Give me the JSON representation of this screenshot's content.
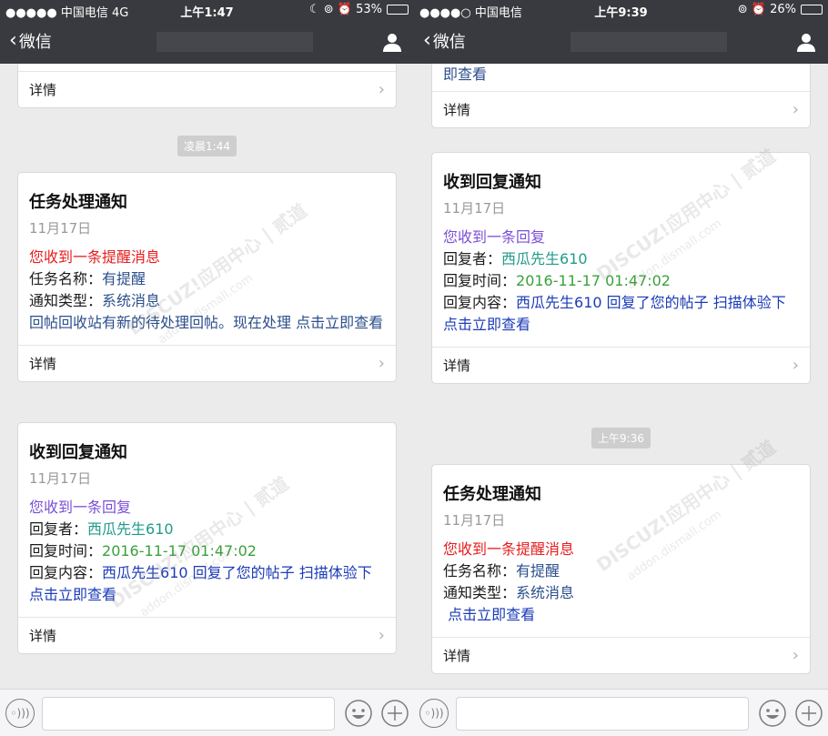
{
  "left": {
    "status": {
      "signal": "●●●●● 中国电信  4G",
      "time": "上午1:47",
      "right": "☾ ⊚ ⏰ 53%"
    },
    "nav": {
      "back_label": "微信"
    },
    "top_fragment": {
      "detail": "详情"
    },
    "time_pill": "凌晨1:44",
    "card1": {
      "title": "任务处理通知",
      "date": "11月17日",
      "line1": "您收到一条提醒消息",
      "line2_label": "任务名称：",
      "line2_value": "有提醒",
      "line3_label": "通知类型：",
      "line3_value": "系统消息",
      "line4": "回帖回收站有新的待处理回帖。现在处理 点击立即查看",
      "detail": "详情"
    },
    "card2": {
      "title": "收到回复通知",
      "date": "11月17日",
      "line1": "您收到一条回复",
      "line2_label": "回复者：",
      "line2_value": "西瓜先生610",
      "line3_label": "回复时间：",
      "line3_value": "2016-11-17 01:47:02",
      "line4_label": "回复内容：",
      "line4_value": "西瓜先生610 回复了您的帖子 扫描体验下",
      "line5": "点击立即查看",
      "detail": "详情"
    }
  },
  "right": {
    "status": {
      "signal": "●●●●○ 中国电信",
      "time": "上午9:39",
      "right": "⊚ ⏰ 26%"
    },
    "nav": {
      "back_label": "微信"
    },
    "top_fragment": {
      "text": "即查看",
      "detail": "详情"
    },
    "card1": {
      "title": "收到回复通知",
      "date": "11月17日",
      "line1": "您收到一条回复",
      "line2_label": "回复者：",
      "line2_value": "西瓜先生610",
      "line3_label": "回复时间：",
      "line3_value": "2016-11-17 01:47:02",
      "line4_label": "回复内容：",
      "line4_value": "西瓜先生610 回复了您的帖子 扫描体验下",
      "line5": "点击立即查看",
      "detail": "详情"
    },
    "time_pill": "上午9:36",
    "card2": {
      "title": "任务处理通知",
      "date": "11月17日",
      "line1": "您收到一条提醒消息",
      "line2_label": "任务名称：",
      "line2_value": "有提醒",
      "line3_label": "通知类型：",
      "line3_value": "系统消息",
      "line4": " 点击立即查看",
      "detail": "详情"
    }
  },
  "colors": {
    "nav_bg": "#393a3f",
    "chat_bg": "#ebebeb",
    "red": "#e61d1d",
    "purple": "#7b4fd6",
    "teal": "#1f9a8a",
    "green": "#3aa13a",
    "blue": "#1b3bb8"
  },
  "battery": {
    "left_level": 0.53,
    "right_level": 0.26
  },
  "watermark": {
    "brand": "DISCUZ!应用中心 | 贰道",
    "url": "addon.dismall.com"
  }
}
